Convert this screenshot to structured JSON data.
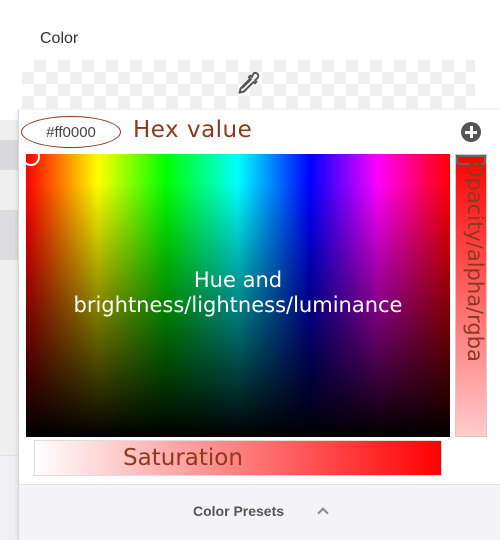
{
  "field": {
    "label": "Color",
    "swatch_icon": "eyedropper-icon"
  },
  "picker": {
    "hex_value": "#ff0000",
    "add_icon": "plus-circle-icon",
    "presets_label": "Color Presets",
    "presets_icon": "chevron-up-icon"
  },
  "annotations": {
    "hex": "Hex value",
    "hue_line1": "Hue and",
    "hue_line2": "brightness/lightness/luminance",
    "opacity": "Opacity/alpha/rgba",
    "saturation": "Saturation"
  },
  "colors": {
    "annotation": "#8b3a1a",
    "selected": "#ff0000"
  }
}
